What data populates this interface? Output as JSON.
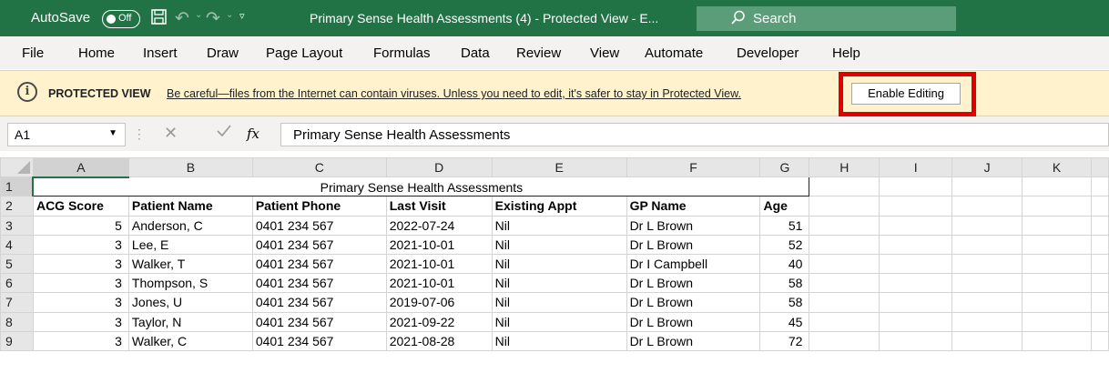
{
  "titlebar": {
    "autosave_label": "AutoSave",
    "autosave_state": "Off",
    "document_title": "Primary Sense Health Assessments (4)  -  Protected View  -  E...",
    "search_label": "Search"
  },
  "menu": [
    "File",
    "Home",
    "Insert",
    "Draw",
    "Page Layout",
    "Formulas",
    "Data",
    "Review",
    "View",
    "Automate",
    "Developer",
    "Help"
  ],
  "protected_view": {
    "label": "PROTECTED VIEW",
    "message": "Be careful—files from the Internet can contain viruses. Unless you need to edit, it's safer to stay in Protected View.",
    "button": "Enable Editing"
  },
  "formula_bar": {
    "cell_ref": "A1",
    "content": "Primary Sense Health Assessments"
  },
  "sheet": {
    "columns": [
      "A",
      "B",
      "C",
      "D",
      "E",
      "F",
      "G",
      "H",
      "I",
      "J",
      "K"
    ],
    "title": "Primary Sense Health Assessments",
    "headers": [
      "ACG Score",
      "Patient Name",
      "Patient Phone",
      "Last Visit",
      "Existing Appt",
      "GP Name",
      "Age"
    ],
    "rows": [
      [
        "5",
        "Anderson, C",
        "0401 234 567",
        "2022-07-24",
        "Nil",
        "Dr L Brown",
        "51"
      ],
      [
        "3",
        "Lee, E",
        "0401 234 567",
        "2021-10-01",
        "Nil",
        "Dr L Brown",
        "52"
      ],
      [
        "3",
        "Walker, T",
        "0401 234 567",
        "2021-10-01",
        "Nil",
        "Dr I Campbell",
        "40"
      ],
      [
        "3",
        "Thompson, S",
        "0401 234 567",
        "2021-10-01",
        "Nil",
        "Dr L Brown",
        "58"
      ],
      [
        "3",
        "Jones, U",
        "0401 234 567",
        "2019-07-06",
        "Nil",
        "Dr L Brown",
        "58"
      ],
      [
        "3",
        "Taylor, N",
        "0401 234 567",
        "2021-09-22",
        "Nil",
        "Dr L Brown",
        "45"
      ],
      [
        "3",
        "Walker, C",
        "0401 234 567",
        "2021-08-28",
        "Nil",
        "Dr L Brown",
        "72"
      ]
    ]
  }
}
